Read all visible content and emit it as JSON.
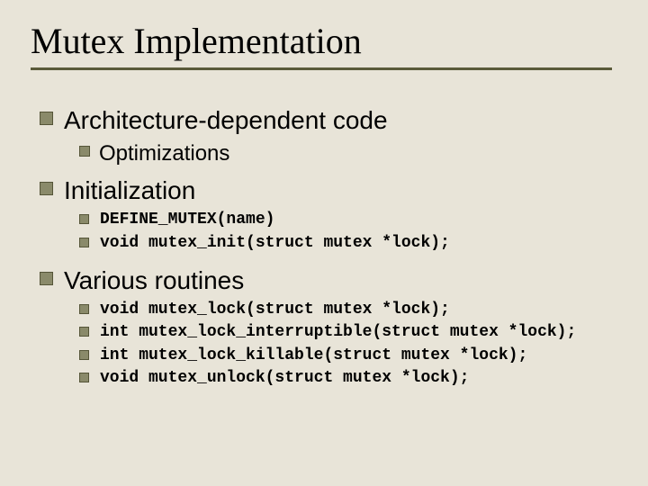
{
  "title": "Mutex Implementation",
  "bullets": {
    "b1": "Architecture-dependent code",
    "b1a": "Optimizations",
    "b2": "Initialization",
    "b2a": "DEFINE_MUTEX(name)",
    "b2b": "void mutex_init(struct mutex *lock);",
    "b3": "Various routines",
    "b3a": "void mutex_lock(struct mutex *lock);",
    "b3b": "int mutex_lock_interruptible(struct mutex *lock);",
    "b3c": "int mutex_lock_killable(struct mutex *lock);",
    "b3d": "void mutex_unlock(struct mutex *lock);"
  }
}
